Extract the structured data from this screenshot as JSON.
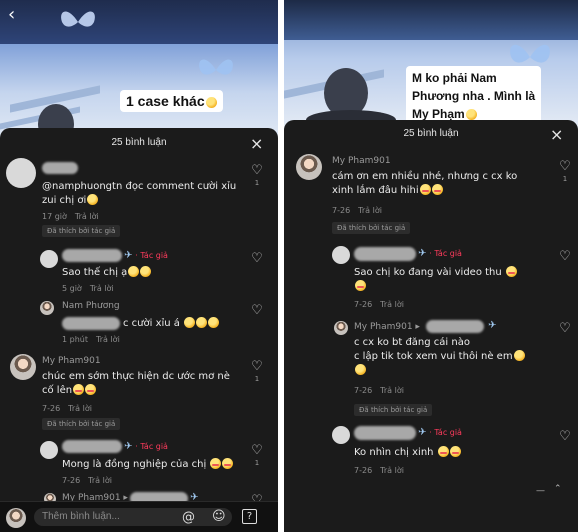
{
  "left": {
    "caption": "1 case khác",
    "sheet_title": "25 bình luận",
    "author_tag": "· Tác giả",
    "comments": [
      {
        "text_line1": "@namphuongtn đọc comment cười xỉu",
        "text_line2": "zui chị ơi",
        "time": "17 giờ",
        "reply": "Trả lời",
        "liked": "Đã thích bởi tác giả",
        "heart_count": "1"
      },
      {
        "text": "Sao thế chị ạ",
        "time": "5 giờ",
        "reply": "Trả lời"
      },
      {
        "username": "Nam Phương",
        "text": "c cười xỉu á",
        "time": "1 phút",
        "reply": "Trả lời"
      },
      {
        "username": "My Pham901",
        "text_line1": "chúc em sớm thực hiện dc ước mơ nè",
        "text_line2": "cố lên",
        "time": "7-26",
        "reply": "Trả lời",
        "liked": "Đã thích bởi tác giả",
        "heart_count": "1"
      },
      {
        "text": "Mong là đồng nghiệp của chị",
        "time": "7-26",
        "reply": "Trả lời",
        "heart_count": "1"
      },
      {
        "username": "My Pham901 ▸"
      }
    ],
    "input_placeholder": "Thêm bình luận..."
  },
  "right": {
    "caption_line1": "M ko phải Nam",
    "caption_line2": "Phương nha . Mình là",
    "caption_line3": "My Phạm",
    "sheet_title": "25 bình luận",
    "author_tag": "· Tác giả",
    "comments": [
      {
        "username": "My Pham901",
        "text_line1": "cám ơn em nhiều nhé, nhưng c cx ko",
        "text_line2": "xinh lắm đâu hihi",
        "time": "7-26",
        "reply": "Trả lời",
        "liked": "Đã thích bởi tác giả",
        "heart_count": "1"
      },
      {
        "text": "Sao chị ko đang vài video thu",
        "time": "7-26",
        "reply": "Trả lời"
      },
      {
        "username": "My Pham901 ▸",
        "text_line1": "c cx ko bt đăng cái nào",
        "text_line2": "c lập tik tok xem vui thôi nè em",
        "time": "7-26",
        "reply": "Trả lời",
        "liked": "Đã thích bởi tác giả"
      },
      {
        "text": "Ko nhìn chị xinh",
        "time": "7-26",
        "reply": "Trả lời"
      }
    ],
    "more": "—"
  }
}
